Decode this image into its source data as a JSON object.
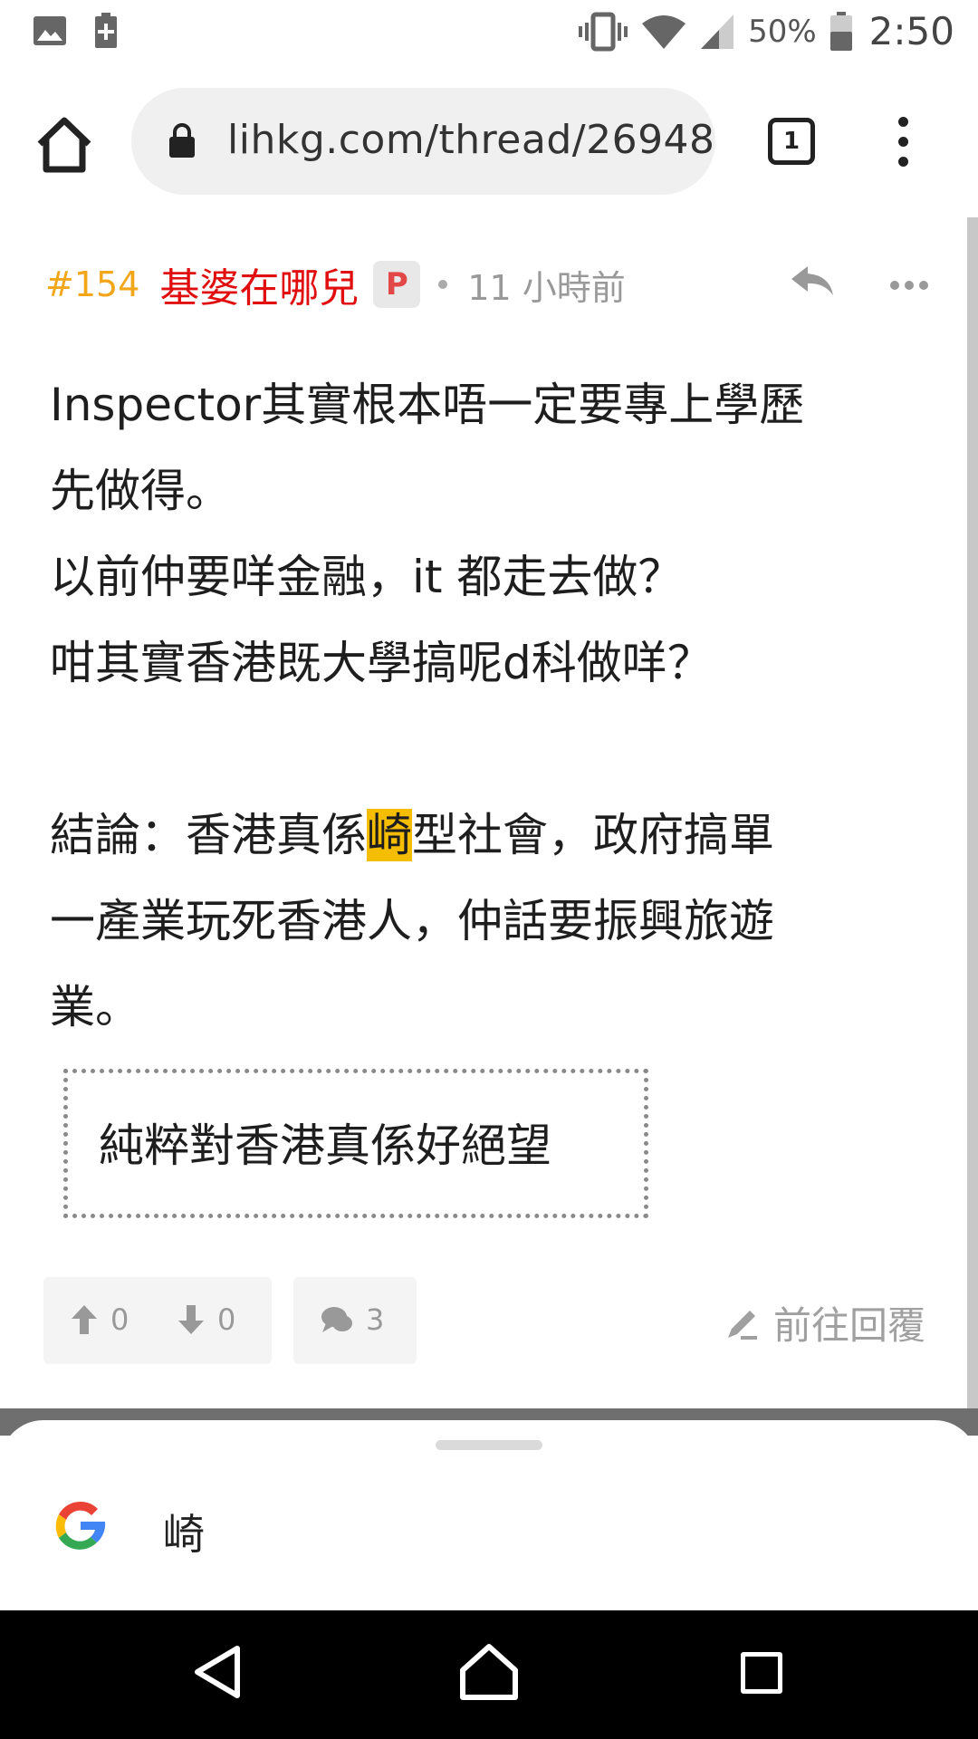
{
  "status_bar": {
    "battery_percent": "50%",
    "time": "2:50"
  },
  "browser": {
    "url": "lihkg.com/thread/26948",
    "tab_count": "1"
  },
  "post": {
    "number": "#154",
    "username": "基婆在哪兒",
    "badge": "P",
    "time": "11 小時前",
    "lines": {
      "l1": "Inspector其實根本唔一定要專上學歷",
      "l2": "先做得。",
      "l3": "以前仲要咩金融，it 都走去做？",
      "l4": "咁其實香港既大學搞呢d科做咩？",
      "l6_pre": "結論：香港真係",
      "l6_hl": "崎",
      "l6_post": "型社會，政府搞單",
      "l7": "一產業玩死香港人，仲話要振興旅遊",
      "l8": "業。"
    },
    "quote": "純粹對香港真係好絕望",
    "upvotes": "0",
    "downvotes": "0",
    "comments": "3",
    "goto_reply": "前往回覆"
  },
  "search_sheet": {
    "term": "崎"
  },
  "colors": {
    "post_number": "#f2a71b",
    "username": "#e00e0e",
    "highlight": "#f5bd00"
  }
}
